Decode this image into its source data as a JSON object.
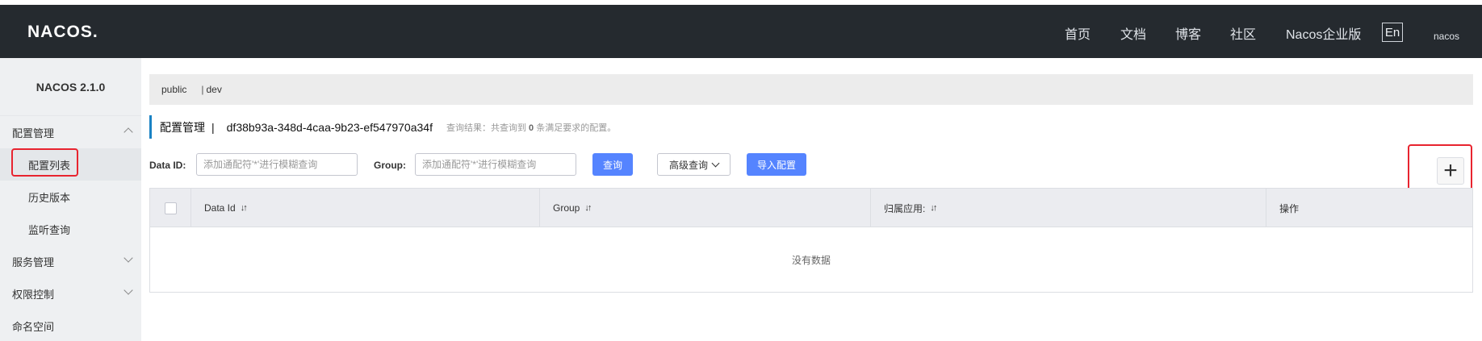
{
  "header": {
    "logo": "NACOS.",
    "nav": [
      "首页",
      "文档",
      "博客",
      "社区",
      "Nacos企业版"
    ],
    "lang_button": "En",
    "user": "nacos"
  },
  "sidebar": {
    "version": "NACOS 2.1.0",
    "groups": [
      {
        "label": "配置管理",
        "expanded": true,
        "items": [
          "配置列表",
          "历史版本",
          "监听查询"
        ]
      },
      {
        "label": "服务管理",
        "expanded": false
      },
      {
        "label": "权限控制",
        "expanded": false
      },
      {
        "label": "命名空间"
      }
    ],
    "active_item": "配置列表"
  },
  "namespace_bar": {
    "public": "public",
    "separator": "|",
    "dev": "dev"
  },
  "page": {
    "title": "配置管理",
    "title_sep": "|",
    "namespace_id": "df38b93a-348d-4caa-9b23-ef547970a34f",
    "result_prefix": "查询结果：共查询到",
    "result_count": "0",
    "result_suffix": "条满足要求的配置。"
  },
  "filters": {
    "data_id_label": "Data ID:",
    "data_id_placeholder": "添加通配符'*'进行模糊查询",
    "group_label": "Group:",
    "group_placeholder": "添加通配符'*'进行模糊查询",
    "search_button": "查询",
    "advanced_button": "高级查询",
    "import_button": "导入配置",
    "add_button": "+"
  },
  "table": {
    "columns": [
      "Data Id",
      "Group",
      "归属应用:",
      "操作"
    ],
    "empty_text": "没有数据"
  },
  "colors": {
    "topbar": "#252a2f",
    "primary": "#5584ff",
    "highlight": "#e8242f",
    "accent": "#1a82c4"
  }
}
